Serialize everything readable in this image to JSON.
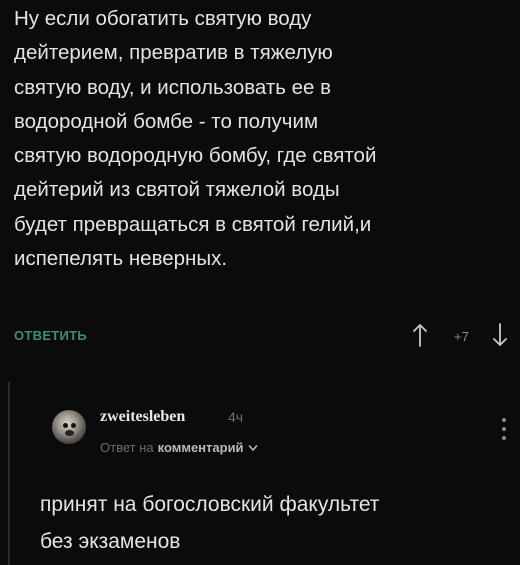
{
  "comment": {
    "text": "Ну если обогатить святую воду\nдейтерием, превратив в тяжелую\nсвятую воду, и использовать ее в\nводородной бомбе - то получим\nсвятую водородную бомбу, где святой\nдейтерий из святой тяжелой воды\nбудет превращаться в святой гелий,и\nиспепелять неверных.",
    "reply_label": "ОТВЕТИТЬ",
    "score": "+7"
  },
  "reply": {
    "username": "zweitesleben",
    "time": "4ч",
    "reply_to_prefix": "Ответ на",
    "reply_to_target": "комментарий",
    "text": "принят на богословский факультет\nбез экзаменов"
  },
  "colors": {
    "accent": "#3e8d78",
    "background": "#0b0b0b",
    "text": "#e3e3e3",
    "muted": "#6c6c6c"
  },
  "icons": {
    "upvote": "arrow-up-icon",
    "downvote": "arrow-down-icon",
    "menu": "kebab-menu-icon",
    "expand": "chevron-down-icon"
  }
}
